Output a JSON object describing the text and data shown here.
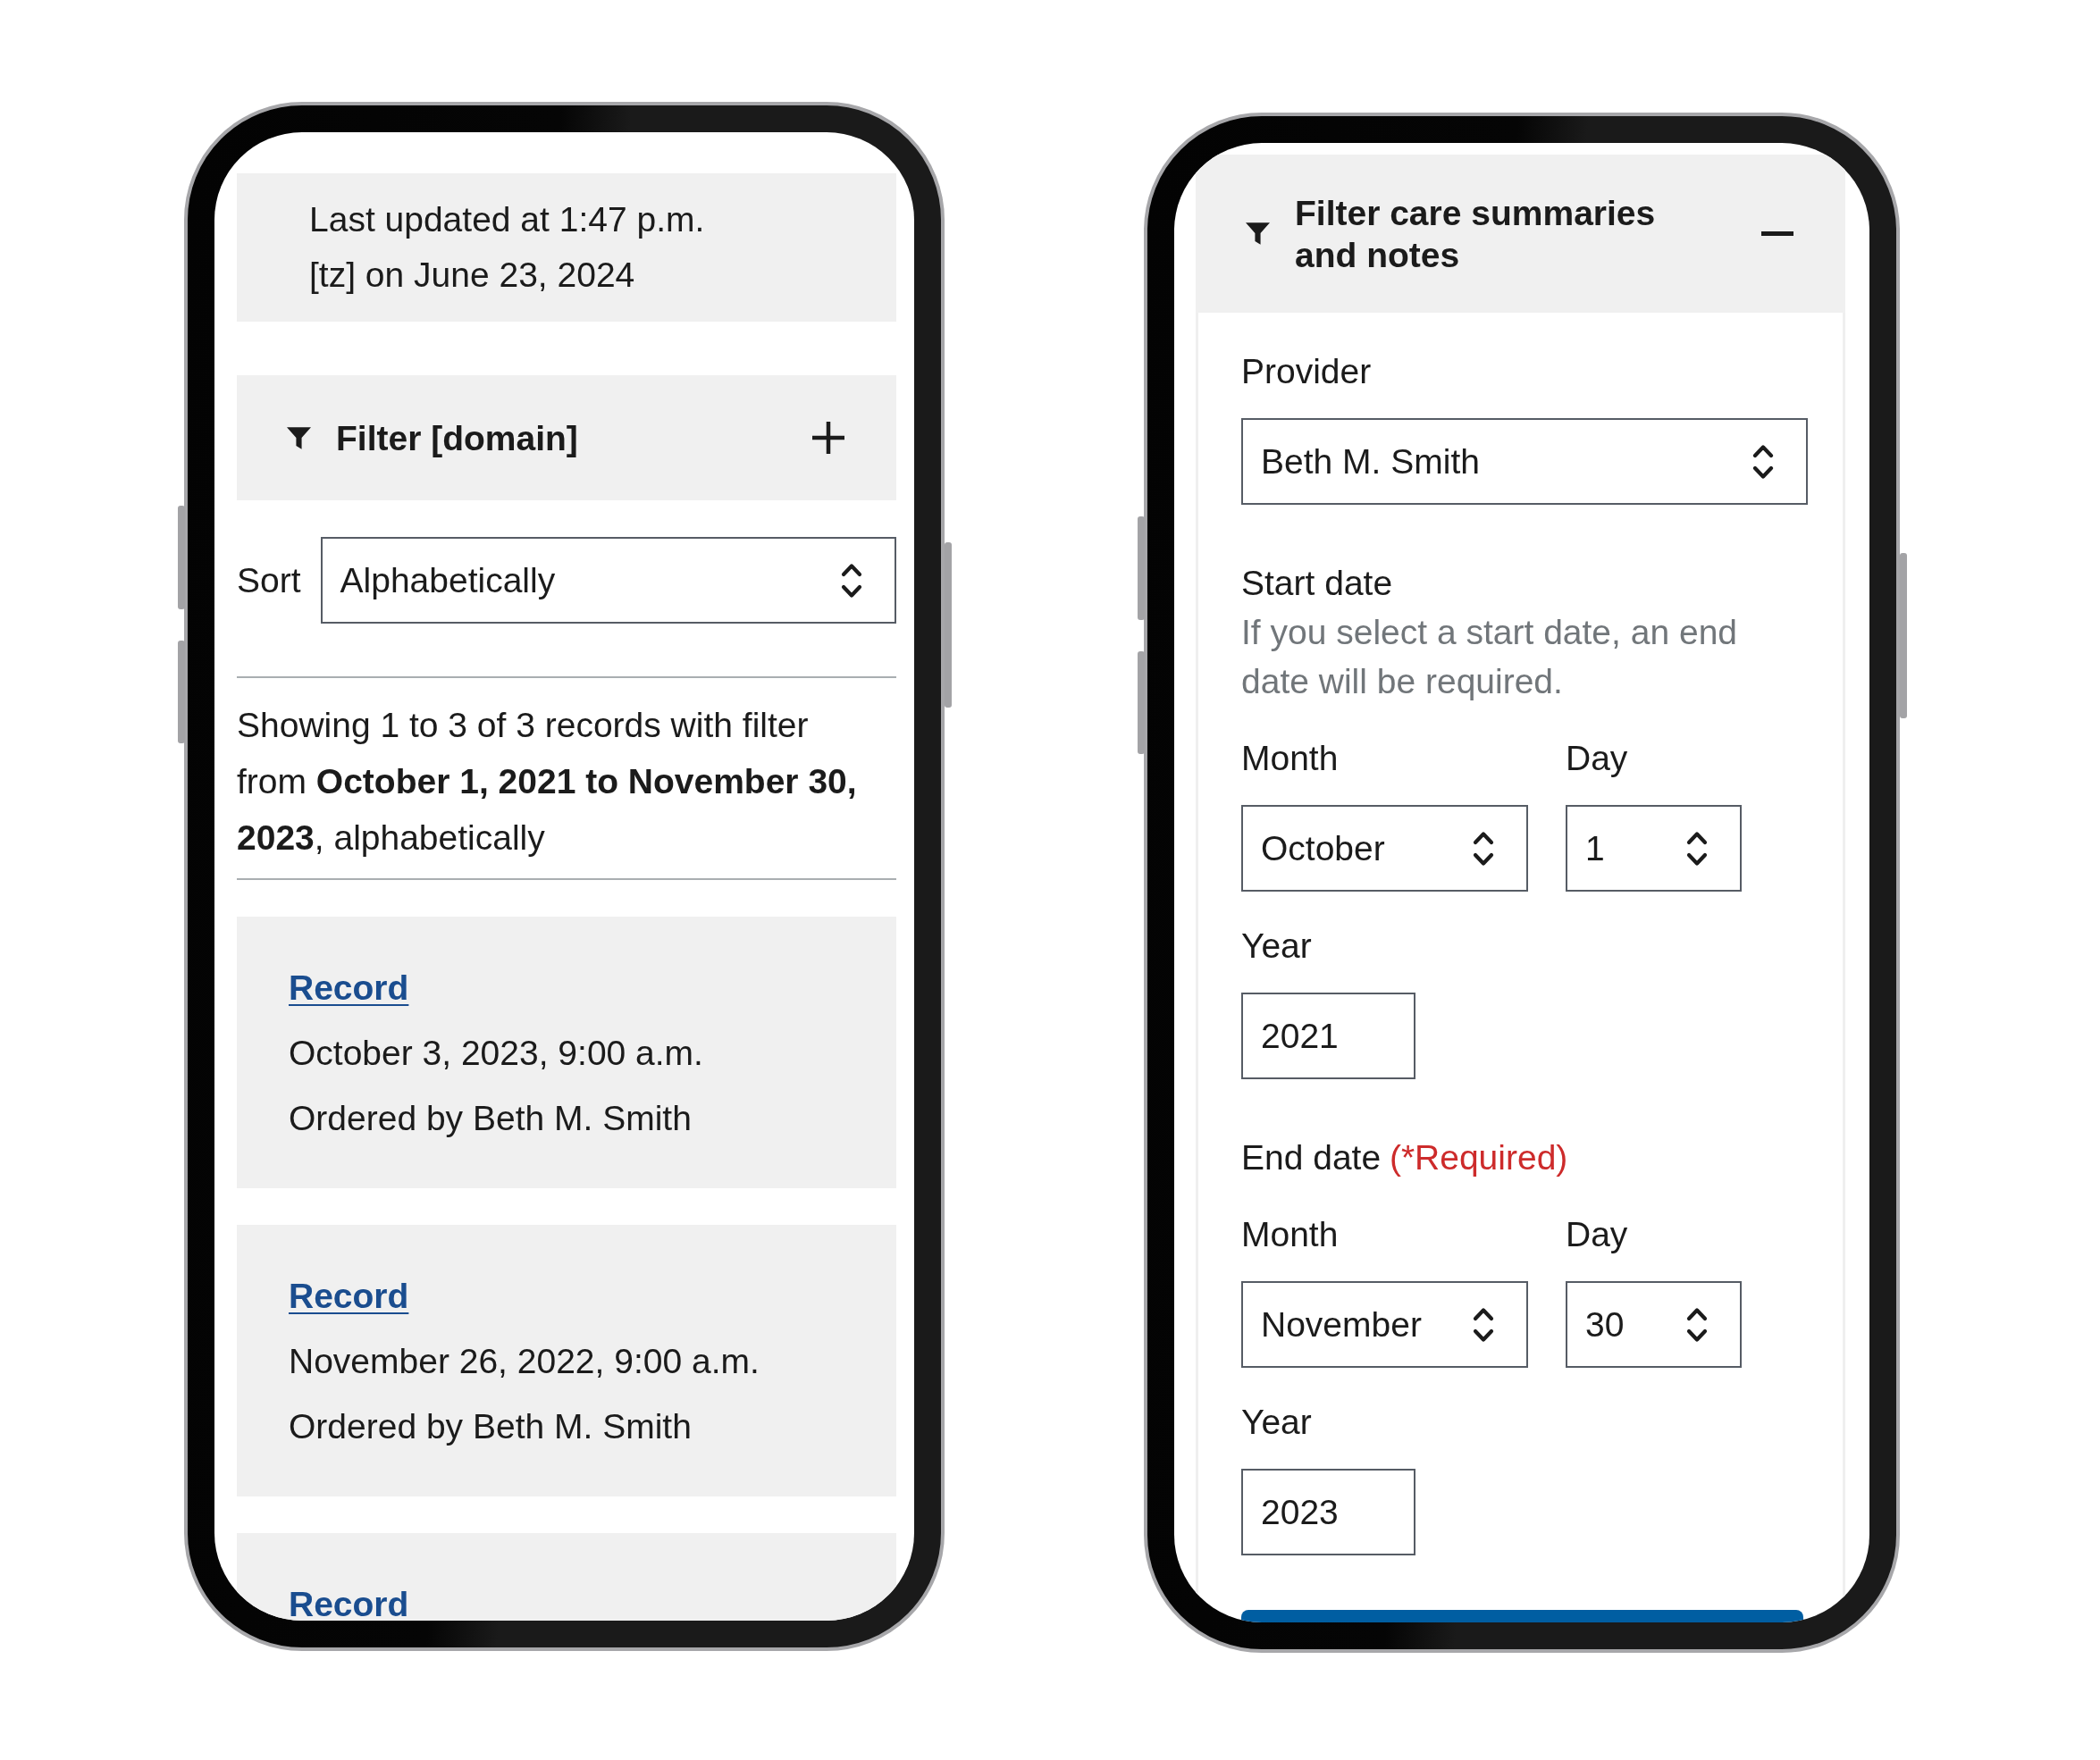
{
  "records_screen": {
    "last_updated": "Last updated at 1:47 p.m. [tz] on June 23, 2024",
    "filter": {
      "title": "Filter [domain]",
      "expanded": false
    },
    "sort": {
      "label": "Sort",
      "value": "Alphabetically"
    },
    "summary": "Showing 1 to 3 of 3 records with filter from **October 1, 2021 to November 30, 2023**, alphabetically",
    "records": [
      {
        "title": "Record",
        "date": "October 3, 2023, 9:00 a.m.",
        "ordered_by": "Ordered by Beth M. Smith"
      },
      {
        "title": "Record",
        "date": "November 26, 2022, 9:00 a.m.",
        "ordered_by": "Ordered by Beth M. Smith"
      },
      {
        "title": "Record"
      }
    ]
  },
  "filter_screen": {
    "filter": {
      "title": "Filter care summaries and notes",
      "expanded": true
    },
    "provider": {
      "label": "Provider",
      "value": "Beth M. Smith"
    },
    "date_ranges": [
      {
        "label": "Start date",
        "hint": "If you select a start date, an end date will be required.",
        "month": {
          "label": "Month",
          "value": "October"
        },
        "day": {
          "label": "Day",
          "value": "1"
        },
        "year": {
          "label": "Year",
          "value": "2021"
        }
      },
      {
        "label": "End date",
        "required_note": "(*Required)",
        "month": {
          "label": "Month",
          "value": "November"
        },
        "day": {
          "label": "Day",
          "value": "30"
        },
        "year": {
          "label": "Year",
          "value": "2023"
        }
      }
    ]
  }
}
